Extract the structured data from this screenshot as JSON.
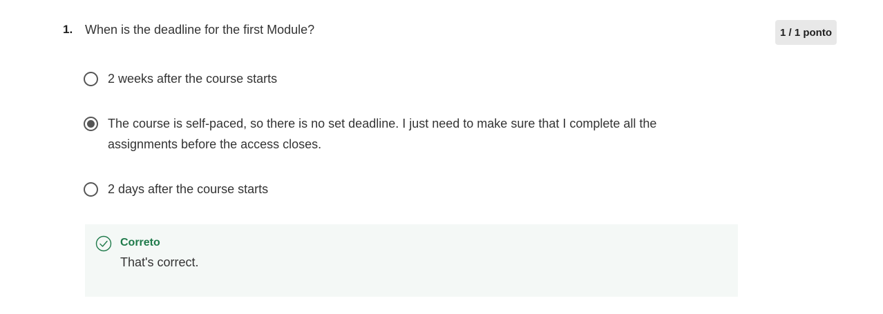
{
  "question": {
    "number": "1.",
    "text": "When is the deadline for the first Module?",
    "score": "1 / 1 ponto",
    "options": [
      {
        "label": "2 weeks after the course starts",
        "selected": false
      },
      {
        "label": "The course is self-paced, so there is no set deadline. I just need to make sure that I complete all the assignments before the access closes.",
        "selected": true
      },
      {
        "label": "2 days after the course starts",
        "selected": false
      }
    ]
  },
  "feedback": {
    "status": "Correto",
    "message": "That's correct.",
    "icon": "check-circle-icon",
    "color": "#1e7a4a",
    "background": "#f4f8f6"
  }
}
